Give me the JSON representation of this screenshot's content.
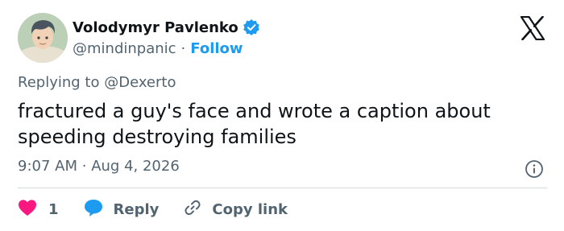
{
  "author": {
    "display_name": "Volodymyr Pavlenko",
    "handle": "@mindinpanic",
    "separator": "·",
    "follow_label": "Follow",
    "avatar_icon": "avatar-illustration",
    "verified_icon": "verified-badge-icon"
  },
  "reply_context": {
    "prefix": "Replying to",
    "mention": "@Dexerto"
  },
  "tweet": {
    "text": "fractured a guy's face and wrote a caption about speeding destroying families",
    "time": "9:07 AM",
    "separator": "·",
    "date": "Aug 4, 2026"
  },
  "actions": {
    "like_count": "1",
    "reply_label": "Reply",
    "copy_link_label": "Copy link"
  },
  "colors": {
    "accent": "#1d9bf0",
    "like": "#f91880",
    "text_primary": "#0f1419",
    "text_secondary": "#536471",
    "divider": "#cfd9de"
  }
}
